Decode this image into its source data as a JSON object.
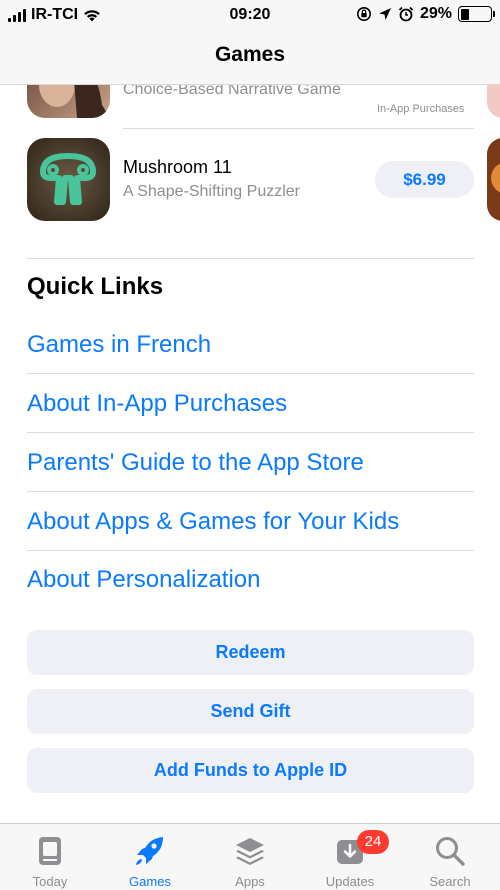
{
  "status": {
    "carrier": "IR-TCI",
    "time": "09:20",
    "battery_percent": "29%",
    "battery_level": 0.29
  },
  "nav": {
    "title": "Games"
  },
  "apps": [
    {
      "subtitle": "Choice-Based Narrative Game",
      "note": "In-App Purchases"
    },
    {
      "name": "Mushroom 11",
      "subtitle": "A Shape-Shifting Puzzler",
      "price": "$6.99"
    }
  ],
  "quick_links": {
    "title": "Quick Links",
    "items": [
      {
        "label": "Games in French"
      },
      {
        "label": "About In-App Purchases"
      },
      {
        "label": "Parents' Guide to the App Store"
      },
      {
        "label": "About Apps & Games for Your Kids"
      },
      {
        "label": "About Personalization"
      }
    ]
  },
  "actions": {
    "redeem": "Redeem",
    "send_gift": "Send Gift",
    "add_funds": "Add Funds to Apple ID"
  },
  "tabs": [
    {
      "label": "Today",
      "icon": "today-icon"
    },
    {
      "label": "Games",
      "icon": "rocket-icon",
      "active": true
    },
    {
      "label": "Apps",
      "icon": "layers-icon"
    },
    {
      "label": "Updates",
      "icon": "download-icon",
      "badge": "24"
    },
    {
      "label": "Search",
      "icon": "search-icon"
    }
  ],
  "colors": {
    "accent": "#0a7aff",
    "badge": "#ff3b30",
    "button_bg": "#eef0f6",
    "secondary_text": "#8e8e93"
  }
}
